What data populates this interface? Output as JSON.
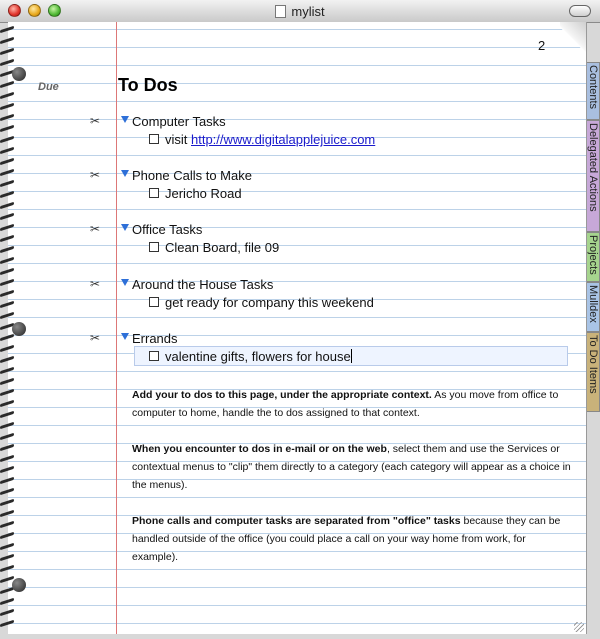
{
  "window": {
    "title": "mylist"
  },
  "page": {
    "number": "2",
    "due_label": "Due",
    "heading": "To Dos"
  },
  "categories": [
    {
      "name": "Computer Tasks",
      "items": [
        {
          "prefix": "visit ",
          "link": "http://www.digitalapplejuice.com"
        }
      ]
    },
    {
      "name": "Phone Calls to Make",
      "items": [
        {
          "text": "Jericho Road"
        }
      ]
    },
    {
      "name": "Office Tasks",
      "items": [
        {
          "text": "Clean Board, file 09"
        }
      ]
    },
    {
      "name": "Around the House Tasks",
      "items": [
        {
          "text": "get ready for company this weekend"
        }
      ]
    },
    {
      "name": "Errands",
      "items": [
        {
          "text": "valentine gifts, flowers for house"
        }
      ]
    }
  ],
  "notes": [
    {
      "bold": "Add your to dos to this page, under the appropriate context.",
      "rest": "  As you move from office to computer to home, handle the to dos assigned to that context."
    },
    {
      "bold": "When you encounter to dos in e-mail or on the web",
      "rest": ", select them and use the Services or contextual menus to \"clip\" them directly to a category (each category will appear as a choice in the menus)."
    },
    {
      "bold": "Phone calls and computer tasks are separated from \"office\" tasks",
      "rest": " because they can be handled outside of the office (you could place a call on your way home from work, for example)."
    }
  ],
  "tabs": [
    {
      "label": "Contents",
      "color": "#a9bfe0"
    },
    {
      "label": "Delegated Actions",
      "color": "#c7a8d8"
    },
    {
      "label": "Projects",
      "color": "#a6d48e"
    },
    {
      "label": "Mulldex",
      "color": "#a9c4e6"
    },
    {
      "label": "To Do Items",
      "color": "#c9b27a"
    }
  ]
}
